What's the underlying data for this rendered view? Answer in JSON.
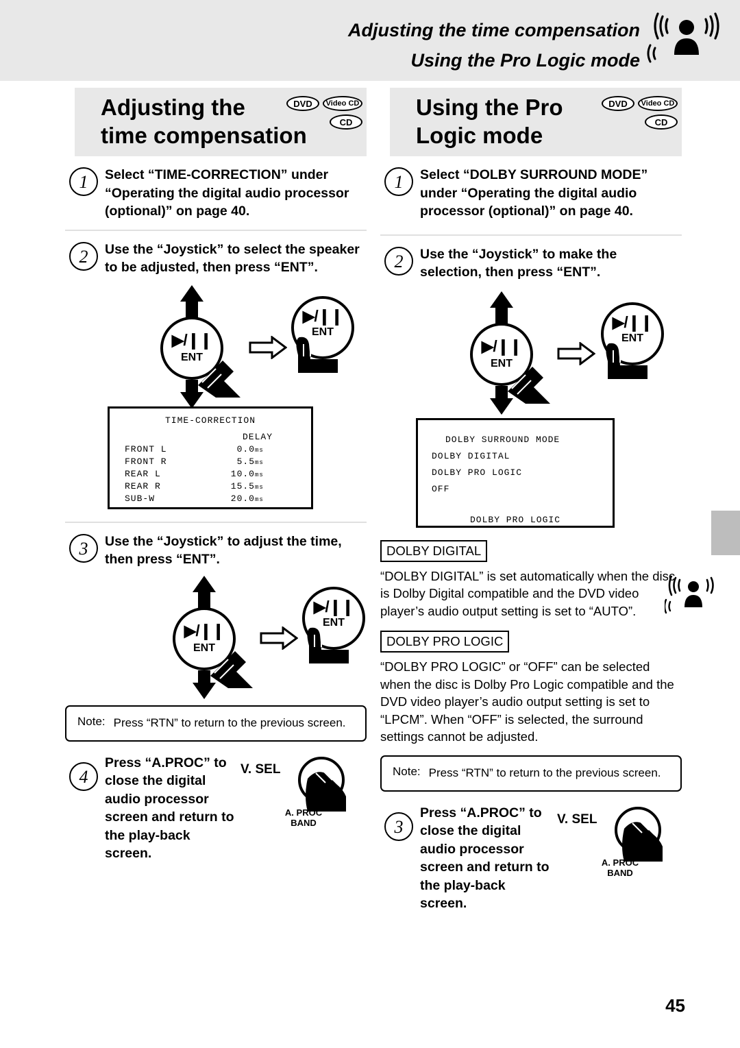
{
  "header": {
    "line1": "Adjusting the time compensation",
    "line2": "Using the Pro Logic mode",
    "speaker_icon": "speaker-with-sound-waves-icon"
  },
  "left": {
    "title": "Adjusting the\ntime compensation",
    "badges": [
      "DVD",
      "Video CD",
      "CD"
    ],
    "steps": [
      {
        "num": "1",
        "text": "Select “TIME-CORRECTION” under “Operating the digital audio processor (optional)” on page 40."
      },
      {
        "num": "2",
        "text": "Use the “Joystick” to select the speaker to  be adjusted, then press “ENT”."
      },
      {
        "num": "3",
        "text": "Use the “Joystick” to adjust the time, then press “ENT”."
      }
    ],
    "knob": {
      "play_pause": "▶/❙❙",
      "ent": "ENT"
    },
    "panel": {
      "title": "TIME-CORRECTION",
      "delay_header": "DELAY",
      "rows": [
        {
          "label": "FRONT L",
          "value": "0.0",
          "unit": "ms"
        },
        {
          "label": "FRONT R",
          "value": "5.5",
          "unit": "ms"
        },
        {
          "label": "REAR  L",
          "value": "10.0",
          "unit": "ms"
        },
        {
          "label": "REAR  R",
          "value": "15.5",
          "unit": "ms"
        },
        {
          "label": "SUB-W",
          "value": "20.0",
          "unit": "ms"
        }
      ]
    },
    "note": {
      "label": "Note:",
      "text": "Press “RTN” to return to the previous screen."
    },
    "final_step": {
      "num": "4",
      "text": "Press “A.PROC” to close the digital audio processor screen and return to the play-back screen.",
      "vsel": "V. SEL",
      "aproc": "A. PROC",
      "band": "BAND"
    }
  },
  "right": {
    "title": "Using the Pro\nLogic mode",
    "badges": [
      "DVD",
      "Video CD",
      "CD"
    ],
    "steps": [
      {
        "num": "1",
        "text": "Select “DOLBY SURROUND MODE” under “Operating the digital audio processor (optional)” on page 40."
      },
      {
        "num": "2",
        "text": "Use the “Joystick” to make the selection, then press “ENT”."
      }
    ],
    "knob": {
      "play_pause": "▶/❙❙",
      "ent": "ENT"
    },
    "panel": {
      "title": "DOLBY SURROUND MODE",
      "options": [
        "DOLBY DIGITAL",
        "DOLBY PRO LOGIC",
        "OFF"
      ],
      "selected": "DOLBY PRO LOGIC"
    },
    "sections": [
      {
        "heading": "DOLBY DIGITAL",
        "body": "“DOLBY DIGITAL” is set automatically when the disc is Dolby Digital compatible and the DVD video player’s audio output setting is set to “AUTO”."
      },
      {
        "heading": "DOLBY PRO LOGIC",
        "body": "“DOLBY PRO LOGIC” or “OFF” can be selected when the disc is Dolby Pro Logic compatible and the DVD video player’s audio output setting is set to “LPCM”. When “OFF” is selected, the surround settings cannot be adjusted."
      }
    ],
    "note": {
      "label": "Note:",
      "text": "Press “RTN” to return to the previous screen."
    },
    "final_step": {
      "num": "3",
      "text": "Press “A.PROC” to close the digital audio processor screen and return to the play-back screen.",
      "vsel": "V. SEL",
      "aproc": "A. PROC",
      "band": "BAND"
    }
  },
  "page_number": "45"
}
